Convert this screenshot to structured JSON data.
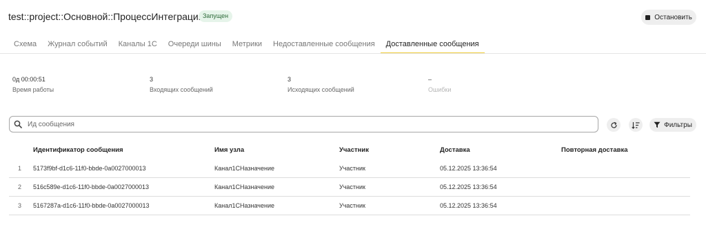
{
  "header": {
    "title": "test::project::Основной::ПроцессИнтеграции",
    "status": "Запущен",
    "stop_label": "Остановить"
  },
  "tabs": [
    {
      "label": "Схема"
    },
    {
      "label": "Журнал событий"
    },
    {
      "label": "Каналы 1С"
    },
    {
      "label": "Очереди шины"
    },
    {
      "label": "Метрики"
    },
    {
      "label": "Недоставленные сообщения"
    },
    {
      "label": "Доставленные сообщения"
    }
  ],
  "active_tab": "Доставленные сообщения",
  "stats": [
    {
      "value": "0д 00:00:51",
      "label": "Время работы"
    },
    {
      "value": "3",
      "label": "Входящих сообщений"
    },
    {
      "value": "3",
      "label": "Исходящих сообщений"
    },
    {
      "value": "–",
      "label": "Ошибки"
    }
  ],
  "search": {
    "placeholder": "Ид сообщения",
    "value": ""
  },
  "toolbar": {
    "filters_label": "Фильтры"
  },
  "table": {
    "columns": [
      "Идентификатор сообщения",
      "Имя узла",
      "Участник",
      "Доставка",
      "Повторная доставка"
    ],
    "rows": [
      {
        "num": "1",
        "id": "5173f9bf-d1c6-11f0-bbde-0a0027000013",
        "node": "Канал1СНазначение",
        "participant": "Участник",
        "delivery": "05.12.2025 13:36:54",
        "redelivery": ""
      },
      {
        "num": "2",
        "id": "516c589e-d1c6-11f0-bbde-0a0027000013",
        "node": "Канал1СНазначение",
        "participant": "Участник",
        "delivery": "05.12.2025 13:36:54",
        "redelivery": ""
      },
      {
        "num": "3",
        "id": "5167287a-d1c6-11f0-bbde-0a0027000013",
        "node": "Канал1СНазначение",
        "participant": "Участник",
        "delivery": "05.12.2025 13:36:54",
        "redelivery": ""
      }
    ]
  },
  "colors": {
    "accent": "#f0cd3a",
    "status_bg": "#e6f4ea",
    "status_text": "#2e6b3a"
  },
  "icons": [
    "stop-icon",
    "search-icon",
    "refresh-icon",
    "sort-icon",
    "filter-icon"
  ]
}
